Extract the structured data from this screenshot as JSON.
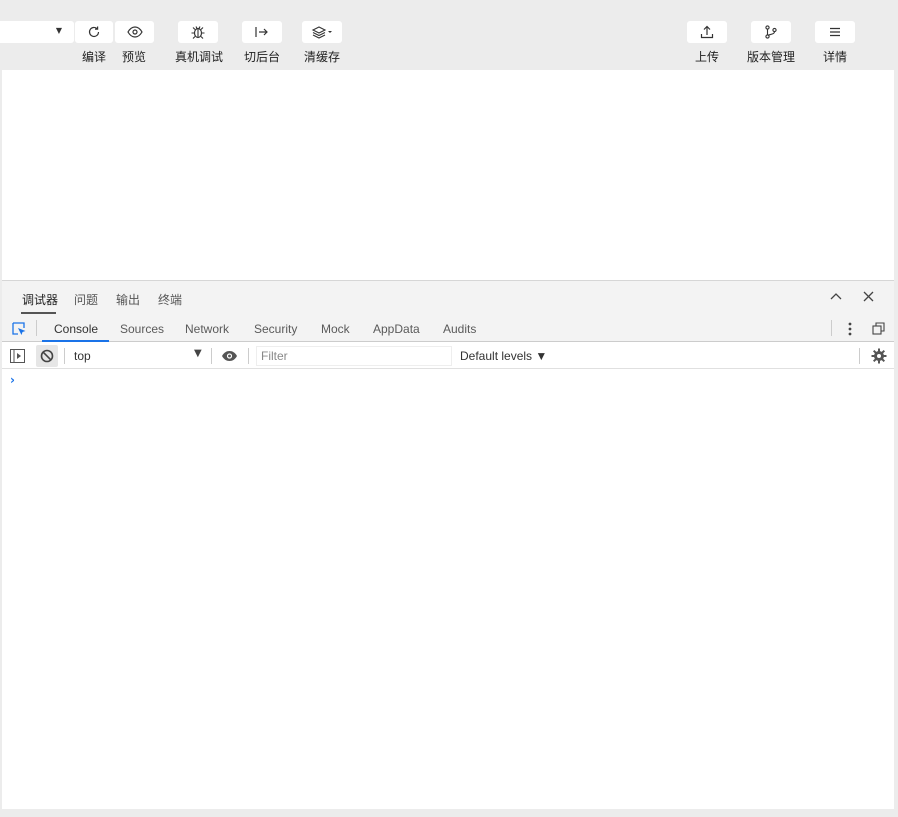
{
  "toolbar": {
    "compile_label": "编译",
    "preview_label": "预览",
    "remote_debug_label": "真机调试",
    "background_label": "切后台",
    "clear_cache_label": "清缓存",
    "upload_label": "上传",
    "version_label": "版本管理",
    "details_label": "详情"
  },
  "icons": {
    "compile": "refresh-icon",
    "preview": "eye-icon",
    "remote_debug": "bug-icon",
    "background": "switch-background-icon",
    "clear_cache": "layers-icon",
    "upload": "upload-icon",
    "version": "branch-icon",
    "details": "menu-icon"
  },
  "panel": {
    "tabs": [
      "调试器",
      "问题",
      "输出",
      "终端"
    ],
    "active_tab": "调试器"
  },
  "devtools": {
    "tabs": [
      "Console",
      "Sources",
      "Network",
      "Security",
      "Mock",
      "AppData",
      "Audits"
    ],
    "active_tab": "Console"
  },
  "console": {
    "context": "top",
    "filter_placeholder": "Filter",
    "filter_value": "",
    "levels": "Default levels",
    "prompt": "›"
  },
  "colors": {
    "accent": "#1a73e8",
    "toolbar_bg": "#ececec",
    "panel_bg": "#f3f3f3"
  }
}
